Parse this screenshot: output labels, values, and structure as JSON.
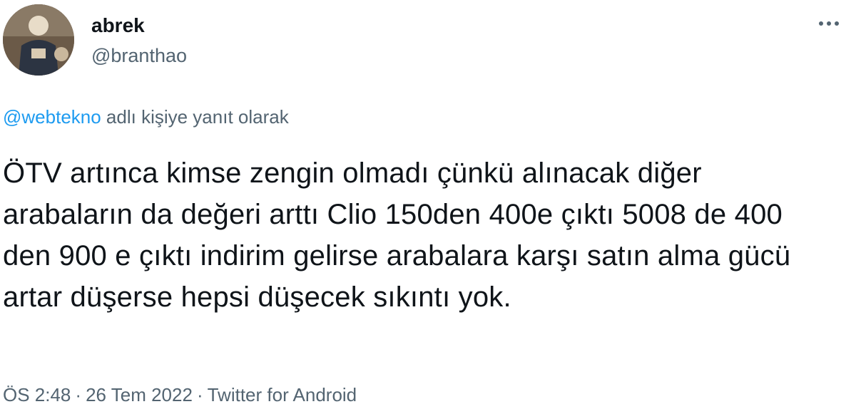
{
  "author": {
    "display_name": "abrek",
    "handle": "@branthao"
  },
  "more_icon": "ellipsis-icon",
  "reply": {
    "mention": "@webtekno",
    "suffix": " adlı kişiye yanıt olarak"
  },
  "tweet": {
    "text": "ÖTV artınca kimse zengin olmadı çünkü alınacak diğer arabaların da değeri arttı Clio 150den 400e çıktı 5008 de 400 den 900 e çıktı indirim gelirse arabalara karşı satın alma gücü artar düşerse hepsi düşecek sıkıntı yok."
  },
  "meta": {
    "time": "ÖS 2:48",
    "separator": "·",
    "date": "26 Tem 2022",
    "source": "Twitter for Android"
  },
  "colors": {
    "text": "#0f1419",
    "secondary": "#536471",
    "link": "#1d9bf0"
  }
}
